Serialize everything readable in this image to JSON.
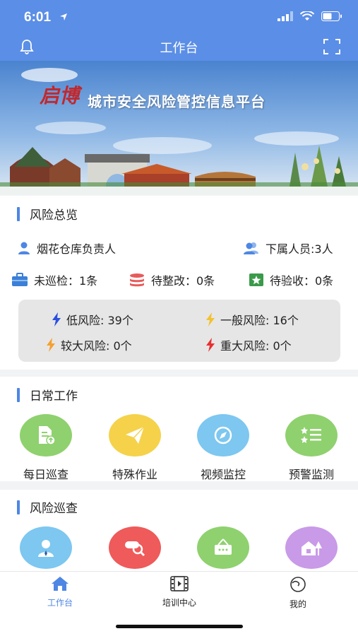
{
  "status_bar": {
    "time": "6:01"
  },
  "nav": {
    "title": "工作台"
  },
  "banner": {
    "brand": "启博",
    "title": "城市安全风险管控信息平台"
  },
  "risk_overview": {
    "title": "风险总览",
    "role": "烟花仓库负责人",
    "subordinates": "下属人员:3人",
    "stats": [
      {
        "label": "未巡检：1条"
      },
      {
        "label": "待整改：0条"
      },
      {
        "label": "待验收：0条"
      }
    ],
    "levels": [
      {
        "label": "低风险: 39个",
        "color": "#2a4fe0"
      },
      {
        "label": "一般风险: 16个",
        "color": "#f2c230"
      },
      {
        "label": "较大风险:  0个",
        "color": "#f5a030"
      },
      {
        "label": "重大风险:  0个",
        "color": "#e83030"
      }
    ]
  },
  "daily_work": {
    "title": "日常工作",
    "items": [
      {
        "label": "每日巡查",
        "color": "#8fd16e",
        "icon": "document-upload-icon"
      },
      {
        "label": "特殊作业",
        "color": "#f5d24a",
        "icon": "paper-plane-icon"
      },
      {
        "label": "视频监控",
        "color": "#7dc7f0",
        "icon": "compass-icon"
      },
      {
        "label": "预警监测",
        "color": "#8fd16e",
        "icon": "star-list-icon"
      }
    ]
  },
  "risk_patrol": {
    "title": "风险巡查",
    "items": [
      {
        "color": "#7dc7f0",
        "icon": "person-icon"
      },
      {
        "color": "#ef5a5a",
        "icon": "search-magnifier-icon"
      },
      {
        "color": "#8fd16e",
        "icon": "sign-board-icon"
      },
      {
        "color": "#c99ae8",
        "icon": "house-tree-icon"
      }
    ]
  },
  "tabs": [
    {
      "label": "工作台",
      "active": true
    },
    {
      "label": "培训中心",
      "active": false
    },
    {
      "label": "我的",
      "active": false
    }
  ],
  "colors": {
    "primary": "#5b8ee6",
    "accent": "#4e86e4"
  }
}
